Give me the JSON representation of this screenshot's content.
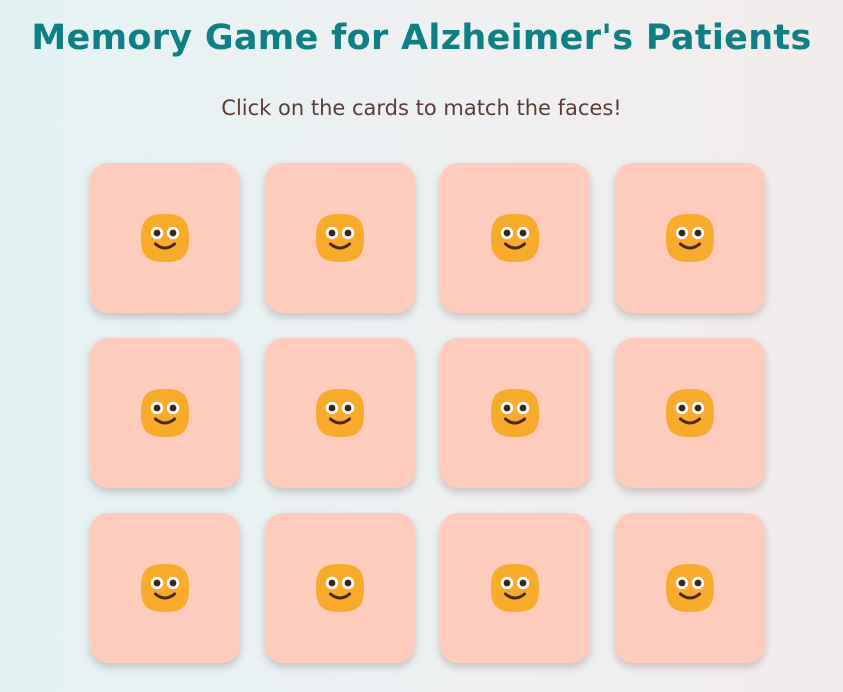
{
  "header": {
    "title": "Memory Game for Alzheimer's Patients",
    "subtitle": "Click on the cards to match the faces!"
  },
  "colors": {
    "title": "#0f7f86",
    "subtitle": "#5a3e36",
    "card_back": "#ffcbbd",
    "face": "#f8ab2a"
  },
  "board": {
    "rows": 3,
    "columns": 4,
    "cards": [
      {
        "state": "face-down",
        "icon": "smiley-face-icon"
      },
      {
        "state": "face-down",
        "icon": "smiley-face-icon"
      },
      {
        "state": "face-down",
        "icon": "smiley-face-icon"
      },
      {
        "state": "face-down",
        "icon": "smiley-face-icon"
      },
      {
        "state": "face-down",
        "icon": "smiley-face-icon"
      },
      {
        "state": "face-down",
        "icon": "smiley-face-icon"
      },
      {
        "state": "face-down",
        "icon": "smiley-face-icon"
      },
      {
        "state": "face-down",
        "icon": "smiley-face-icon"
      },
      {
        "state": "face-down",
        "icon": "smiley-face-icon"
      },
      {
        "state": "face-down",
        "icon": "smiley-face-icon"
      },
      {
        "state": "face-down",
        "icon": "smiley-face-icon"
      },
      {
        "state": "face-down",
        "icon": "smiley-face-icon"
      }
    ]
  }
}
